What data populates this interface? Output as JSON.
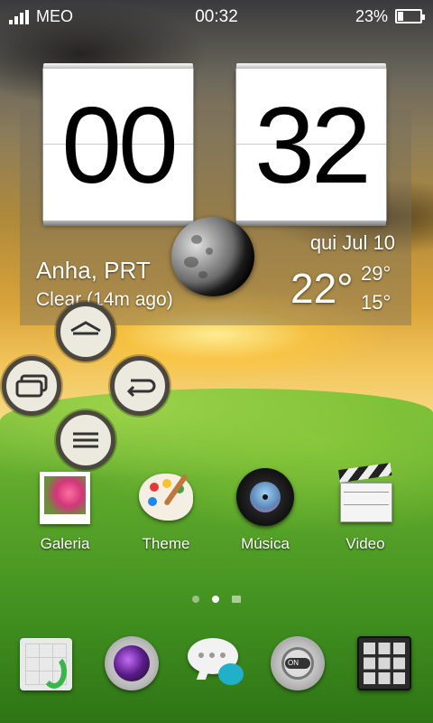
{
  "status_bar": {
    "carrier": "MEO",
    "time": "00:32",
    "battery": "23%",
    "battery_level": 0.23,
    "signal_icon": "cell-signal-icon",
    "battery_icon": "battery-icon"
  },
  "clock_widget": {
    "hours": "00",
    "minutes": "32",
    "date": "qui Jul 10"
  },
  "weather_widget": {
    "location": "Anha, PRT",
    "condition": "Clear (14m ago)",
    "temperature": "22°",
    "high": "29°",
    "low": "15°",
    "icon": "moon-icon"
  },
  "nav_controls": {
    "home_icon": "home-icon",
    "recents_icon": "recent-apps-icon",
    "back_icon": "back-icon",
    "menu_icon": "menu-icon"
  },
  "apps": [
    {
      "label": "Galeria",
      "icon": "gallery-icon"
    },
    {
      "label": "Theme",
      "icon": "palette-icon"
    },
    {
      "label": "Música",
      "icon": "music-disc-icon"
    },
    {
      "label": "Video",
      "icon": "clapperboard-icon"
    }
  ],
  "page_indicator": {
    "pages": 3,
    "active": 1
  },
  "dock": [
    {
      "icon": "phone-dialer-icon"
    },
    {
      "icon": "camera-icon"
    },
    {
      "icon": "messages-icon"
    },
    {
      "icon": "settings-icon"
    },
    {
      "icon": "app-drawer-icon"
    }
  ],
  "colors": {
    "nav_button_fill": "#ece9df",
    "nav_button_ring": "#4b473f",
    "widget_panel": "#786e5a"
  }
}
